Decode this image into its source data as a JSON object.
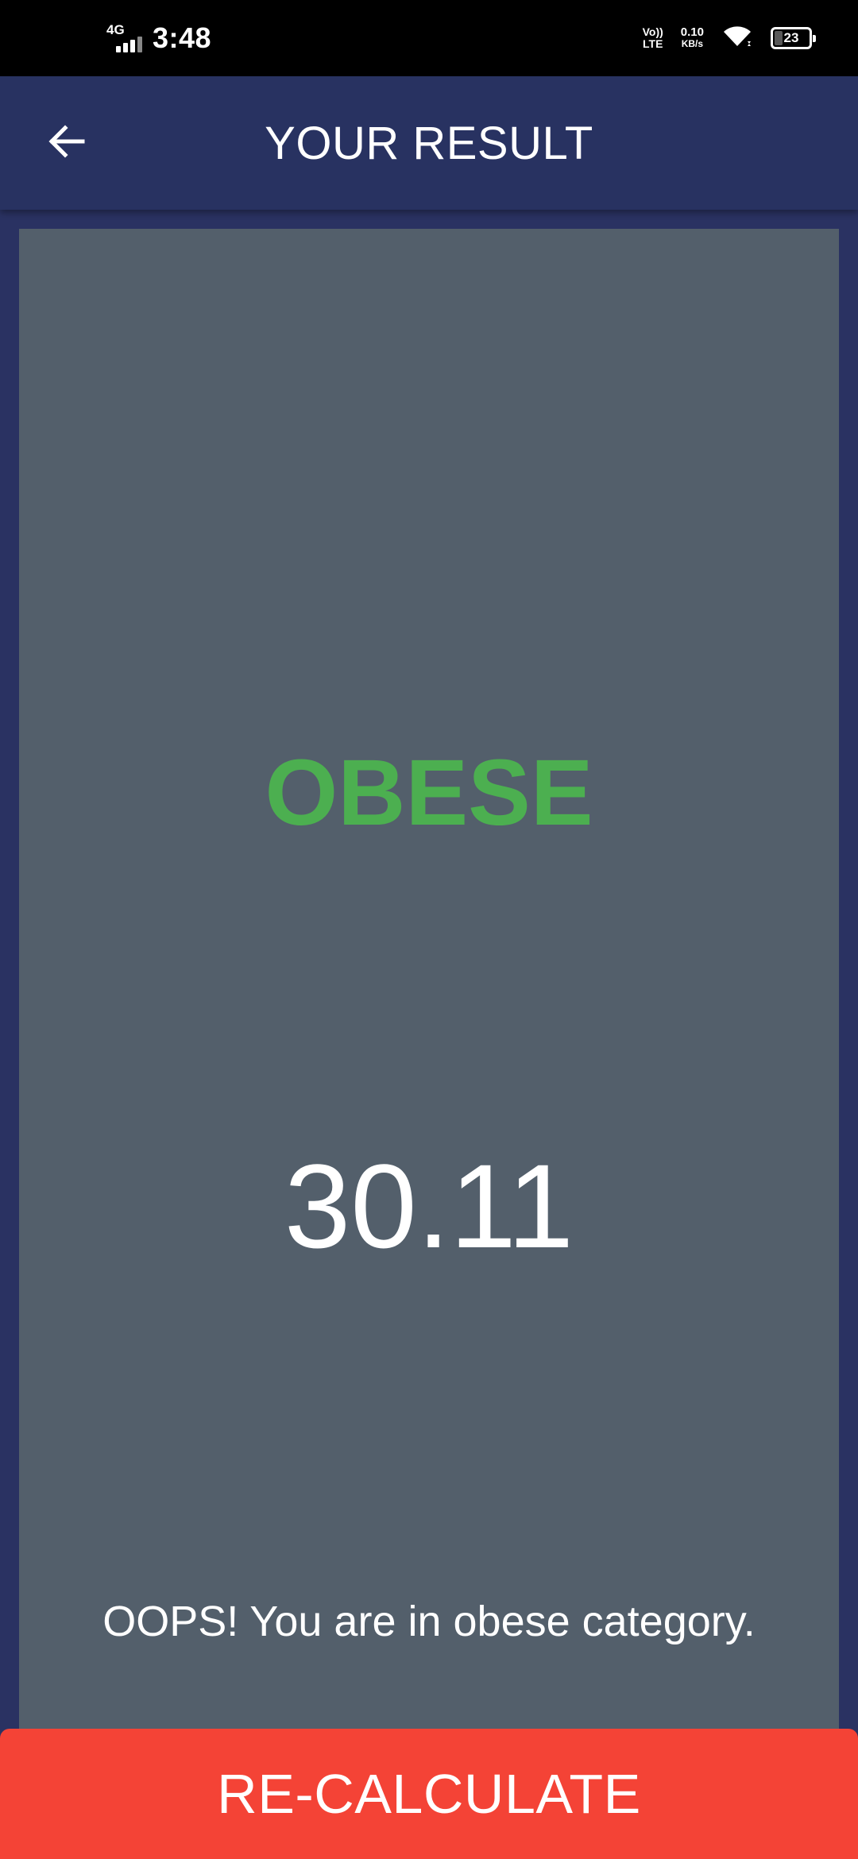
{
  "status_bar": {
    "network_type": "4G",
    "signal_bars": 3,
    "time": "3:48",
    "volte_line1": "Vo))",
    "volte_line2": "LTE",
    "net_speed_value": "0.10",
    "net_speed_unit": "KB/s",
    "wifi_icon": "wifi-icon",
    "battery_level": "23"
  },
  "app_bar": {
    "back_icon": "arrow-left-icon",
    "title": "YOUR RESULT"
  },
  "result": {
    "status_label": "OBESE",
    "status_color": "#4caf50",
    "bmi_value": "30.11",
    "interpretation": "OOPS! You are in obese category."
  },
  "actions": {
    "recalculate_label": "RE-CALCULATE",
    "recalculate_color": "#f44336"
  },
  "colors": {
    "background": "#2a3262",
    "card": "#535f6b",
    "app_bar": "#283261"
  }
}
